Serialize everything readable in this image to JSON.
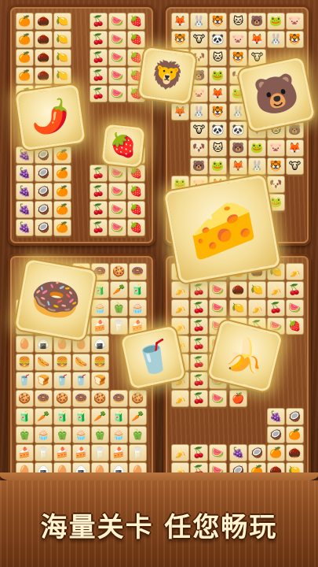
{
  "game": {
    "slogan": "海量关卡  任您畅玩",
    "tile_symbols": {
      "fruit": [
        "🍇",
        "🍉",
        "🍊",
        "🍎",
        "🍋",
        "🍏",
        "🍒",
        "🥥",
        "🍓",
        "🌰",
        "🫐",
        "🍌"
      ],
      "animal": [
        "🐱",
        "🐷",
        "🐯",
        "🐶",
        "🐸",
        "🐰",
        "🐼",
        "🐻",
        "🦊",
        "🐮"
      ],
      "mix": [
        "🍩",
        "🍔",
        "🥛",
        "🧃",
        "🍞",
        "🥚",
        "🧁",
        "🍪",
        "🌭",
        "🍰",
        "🥕",
        "🥤",
        "🍙",
        "🫑"
      ]
    },
    "featured_tiles": [
      {
        "name": "chili-tile",
        "icon": "chili-pepper-icon",
        "glyph": "🌶️"
      },
      {
        "name": "strawberry-tile",
        "icon": "strawberry-icon",
        "glyph": "🍓"
      },
      {
        "name": "lion-tile",
        "icon": "lion-icon",
        "glyph": "🦁"
      },
      {
        "name": "bear-tile",
        "icon": "blue-bear-icon",
        "glyph": "🐻"
      },
      {
        "name": "cheese-tile",
        "icon": "cheese-icon",
        "glyph": "🧀"
      },
      {
        "name": "donut-tile",
        "icon": "donut-icon",
        "glyph": "🍩"
      },
      {
        "name": "drink-tile",
        "icon": "drink-cup-icon",
        "glyph": "🥤"
      },
      {
        "name": "banana-tile",
        "icon": "banana-icon",
        "glyph": "🍌"
      }
    ],
    "colors": {
      "wood_dark": "#5a2c12",
      "tile": "#f4dd97",
      "glow": "#ffe678",
      "slogan": "#fff4cf"
    }
  }
}
